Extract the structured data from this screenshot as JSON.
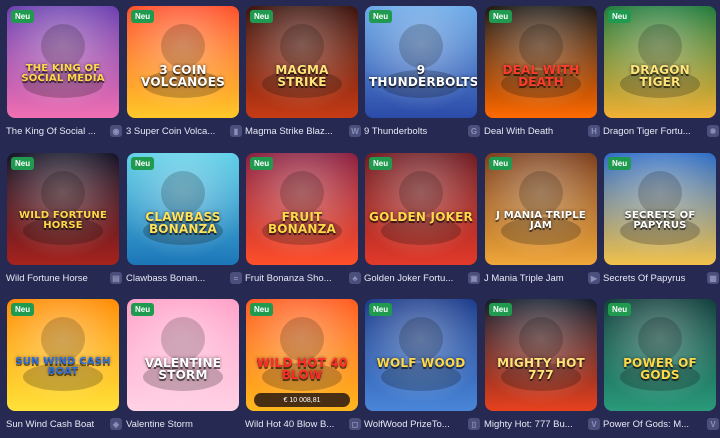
{
  "badge_label": "Neu",
  "games": [
    {
      "name": "The King Of Social ...",
      "art": "THE KING OF SOCIAL MEDIA",
      "bg": [
        "#6a3fb0",
        "#f06fb2"
      ],
      "title_color": "#ffd84a",
      "provider_icon": "provider-logo-icon",
      "provider_glyph": "◉"
    },
    {
      "name": "3 Super Coin Volca...",
      "art": "3 COIN VOLCANOES",
      "bg": [
        "#ff4e2a",
        "#ffc82a"
      ],
      "title_color": "#ffffff",
      "provider_icon": "provider-logo-icon",
      "provider_glyph": "▮"
    },
    {
      "name": "Magma Strike Blaz...",
      "art": "MAGMA STRIKE",
      "bg": [
        "#3a120c",
        "#c63b15"
      ],
      "title_color": "#ffe47a",
      "provider_icon": "provider-logo-icon",
      "provider_glyph": "W"
    },
    {
      "name": "9 Thunderbolts",
      "art": "9 THUNDERBOLTS",
      "bg": [
        "#6aa9e8",
        "#2b4ba8"
      ],
      "title_color": "#ffffff",
      "provider_icon": "provider-logo-icon",
      "provider_glyph": "G"
    },
    {
      "name": "Deal With Death",
      "art": "DEAL WITH DEATH",
      "bg": [
        "#1a1612",
        "#ff6a00"
      ],
      "title_color": "#ff3b2a",
      "provider_icon": "provider-logo-icon",
      "provider_glyph": "H"
    },
    {
      "name": "Dragon Tiger Fortu...",
      "art": "DRAGON TIGER",
      "bg": [
        "#1d7a3a",
        "#f2b134"
      ],
      "title_color": "#ffe47a",
      "provider_icon": "provider-logo-icon",
      "provider_glyph": "❋"
    },
    {
      "name": "Wild Fortune Horse",
      "art": "WILD FORTUNE HORSE",
      "bg": [
        "#121226",
        "#a7231d"
      ],
      "title_color": "#ffd84a",
      "provider_icon": "provider-logo-icon",
      "provider_glyph": "▤"
    },
    {
      "name": "Clawbass Bonan...",
      "art": "CLAWBASS BONANZA",
      "bg": [
        "#5fd0e8",
        "#1c76b8"
      ],
      "title_color": "#ffe25a",
      "provider_icon": "provider-logo-icon",
      "provider_glyph": "≈"
    },
    {
      "name": "Fruit Bonanza Sho...",
      "art": "FRUIT BONANZA",
      "bg": [
        "#8a1e3f",
        "#ff4f2a"
      ],
      "title_color": "#ffd84a",
      "provider_icon": "provider-logo-icon",
      "provider_glyph": "♣"
    },
    {
      "name": "Golden Joker Fortu...",
      "art": "GOLDEN JOKER",
      "bg": [
        "#6d1a20",
        "#e23a2a"
      ],
      "title_color": "#ffd84a",
      "provider_icon": "provider-logo-icon",
      "provider_glyph": "▣"
    },
    {
      "name": "J Mania Triple Jam",
      "art": "J MANIA TRIPLE JAM",
      "bg": [
        "#7a3c1a",
        "#f0a73a"
      ],
      "title_color": "#ffffff",
      "provider_icon": "provider-logo-icon",
      "provider_glyph": "▶"
    },
    {
      "name": "Secrets Of Papyrus",
      "art": "SECRETS OF PAPYRUS",
      "bg": [
        "#2b6bc7",
        "#f2c24a"
      ],
      "title_color": "#ffffff",
      "provider_icon": "provider-logo-icon",
      "provider_glyph": "▦"
    },
    {
      "name": "Sun Wind Cash Boat",
      "art": "SUN WIND CASH BOAT",
      "bg": [
        "#ff8a00",
        "#ffe23a"
      ],
      "title_color": "#2a6de0",
      "provider_icon": "provider-logo-icon",
      "provider_glyph": "◈"
    },
    {
      "name": "Valentine Storm",
      "art": "VALENTINE STORM",
      "bg": [
        "#ff9fc7",
        "#ffd2e5"
      ],
      "title_color": "#ffffff",
      "provider_icon": "",
      "provider_glyph": ""
    },
    {
      "name": "Wild Hot 40 Blow B...",
      "art": "WILD HOT 40 BLOW",
      "bg": [
        "#ff5a1e",
        "#ffb81e"
      ],
      "title_color": "#ff2a2a",
      "provider_icon": "provider-logo-icon",
      "provider_glyph": "◻",
      "jackpot": "€ 10 008,81"
    },
    {
      "name": "WolfWood PrizeTo...",
      "art": "WOLF WOOD",
      "bg": [
        "#1a3a8a",
        "#4a86d8"
      ],
      "title_color": "#ffd84a",
      "provider_icon": "provider-logo-icon",
      "provider_glyph": "▯"
    },
    {
      "name": "Mighty Hot: 777 Bu...",
      "art": "MIGHTY HOT 777",
      "bg": [
        "#0f1a2a",
        "#e8411e"
      ],
      "title_color": "#ffe47a",
      "provider_icon": "provider-logo-icon",
      "provider_glyph": "V"
    },
    {
      "name": "Power Of Gods: M...",
      "art": "POWER OF GODS",
      "bg": [
        "#0f3d3a",
        "#2a9a7a"
      ],
      "title_color": "#ffd84a",
      "provider_icon": "provider-logo-icon",
      "provider_glyph": "V"
    }
  ]
}
